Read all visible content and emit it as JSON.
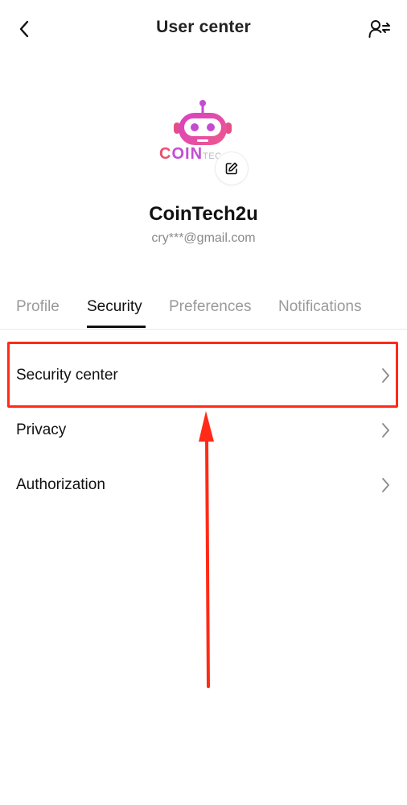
{
  "header": {
    "title": "User center",
    "back_icon": "chevron-left-icon",
    "user_switch_icon": "user-switch-icon"
  },
  "profile": {
    "logo_text_part1": "C",
    "logo_text_part2": "OIN",
    "logo_text_part3": "TEC",
    "username": "CoinTech2u",
    "email": "cry***@gmail.com",
    "edit_icon": "edit-icon"
  },
  "tabs": [
    {
      "label": "Profile",
      "active": false
    },
    {
      "label": "Security",
      "active": true
    },
    {
      "label": "Preferences",
      "active": false
    },
    {
      "label": "Notifications",
      "active": false
    }
  ],
  "security_items": [
    {
      "label": "Security center",
      "icon": "chevron-right-icon"
    },
    {
      "label": "Privacy",
      "icon": "chevron-right-icon"
    },
    {
      "label": "Authorization",
      "icon": "chevron-right-icon"
    }
  ],
  "colors": {
    "annotation_red": "#ff2a17",
    "brand_pink": "#e8506e",
    "brand_purple": "#c34dd4",
    "active_tab": "#111111",
    "inactive_tab": "#9a9a9a"
  }
}
